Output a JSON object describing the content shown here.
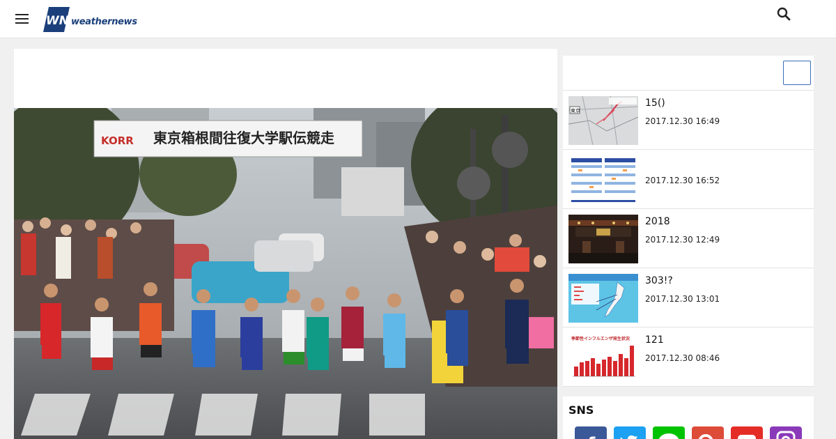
{
  "header": {
    "brand": "weathernews",
    "menu_icon": "hamburger-menu-icon",
    "search_icon": "search-icon"
  },
  "main": {
    "photo_banner": "東京箱根間往復大学駅伝競走",
    "photo_banner_logo": "KORR"
  },
  "sidebar": {
    "news": [
      {
        "title": "15()",
        "date": "2017.12.30 16:49"
      },
      {
        "title": "",
        "date": "2017.12.30 16:52"
      },
      {
        "title": "2018",
        "date": "2017.12.30 12:49"
      },
      {
        "title": "303!?",
        "date": "2017.12.30 13:01"
      },
      {
        "title": "121",
        "date": "2017.12.30 08:46"
      }
    ],
    "thumb_labels": {
      "map_city": "東京",
      "chart_title": "季節性インフルエンザ発生状況"
    }
  },
  "sns": {
    "title": "SNS",
    "icons": [
      "facebook-icon",
      "twitter-icon",
      "line-icon",
      "google-plus-icon",
      "youtube-icon",
      "instagram-icon"
    ]
  },
  "colors": {
    "brand_blue": "#1a3f7a",
    "facebook": "#3b5998",
    "twitter": "#1da1f2",
    "line": "#00c300",
    "google_plus": "#dd4b39",
    "youtube": "#e52d27",
    "instagram": "#8a3ab9"
  }
}
